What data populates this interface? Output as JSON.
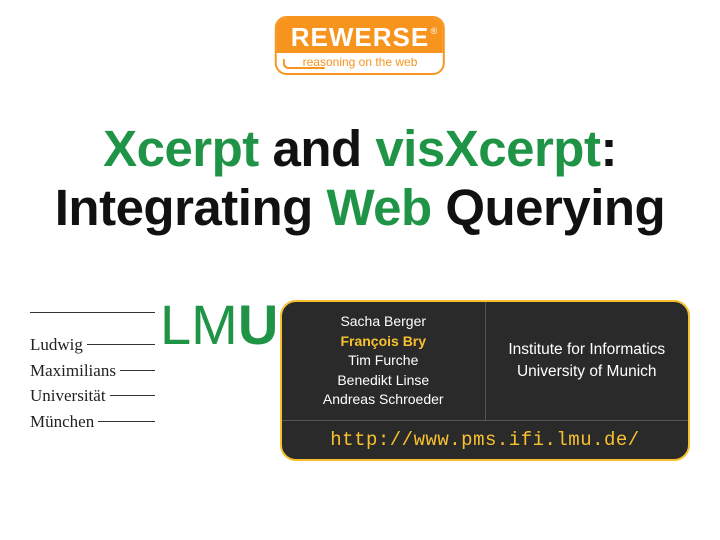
{
  "logo": {
    "main": "REWERSE",
    "registered": "®",
    "sub": "reasoning on the web"
  },
  "title": {
    "seg1": "Xcerpt",
    "seg2": " and ",
    "seg3": "visXcerpt",
    "seg4": ":",
    "seg5": "Integrating ",
    "seg6": "Web",
    "seg7": " Querying"
  },
  "lmu": {
    "letters": {
      "l": "L",
      "m": "M",
      "u": "U"
    },
    "words": [
      "Ludwig",
      "Maximilians",
      "Universität",
      "München"
    ]
  },
  "info": {
    "authors": [
      "Sacha Berger",
      "François Bry",
      "Tim Furche",
      "Benedikt Linse",
      "Andreas Schroeder"
    ],
    "highlighted_index": 1,
    "institute_line1": "Institute for Informatics",
    "institute_line2": "University of Munich",
    "url": "http://www.pms.ifi.lmu.de/"
  }
}
